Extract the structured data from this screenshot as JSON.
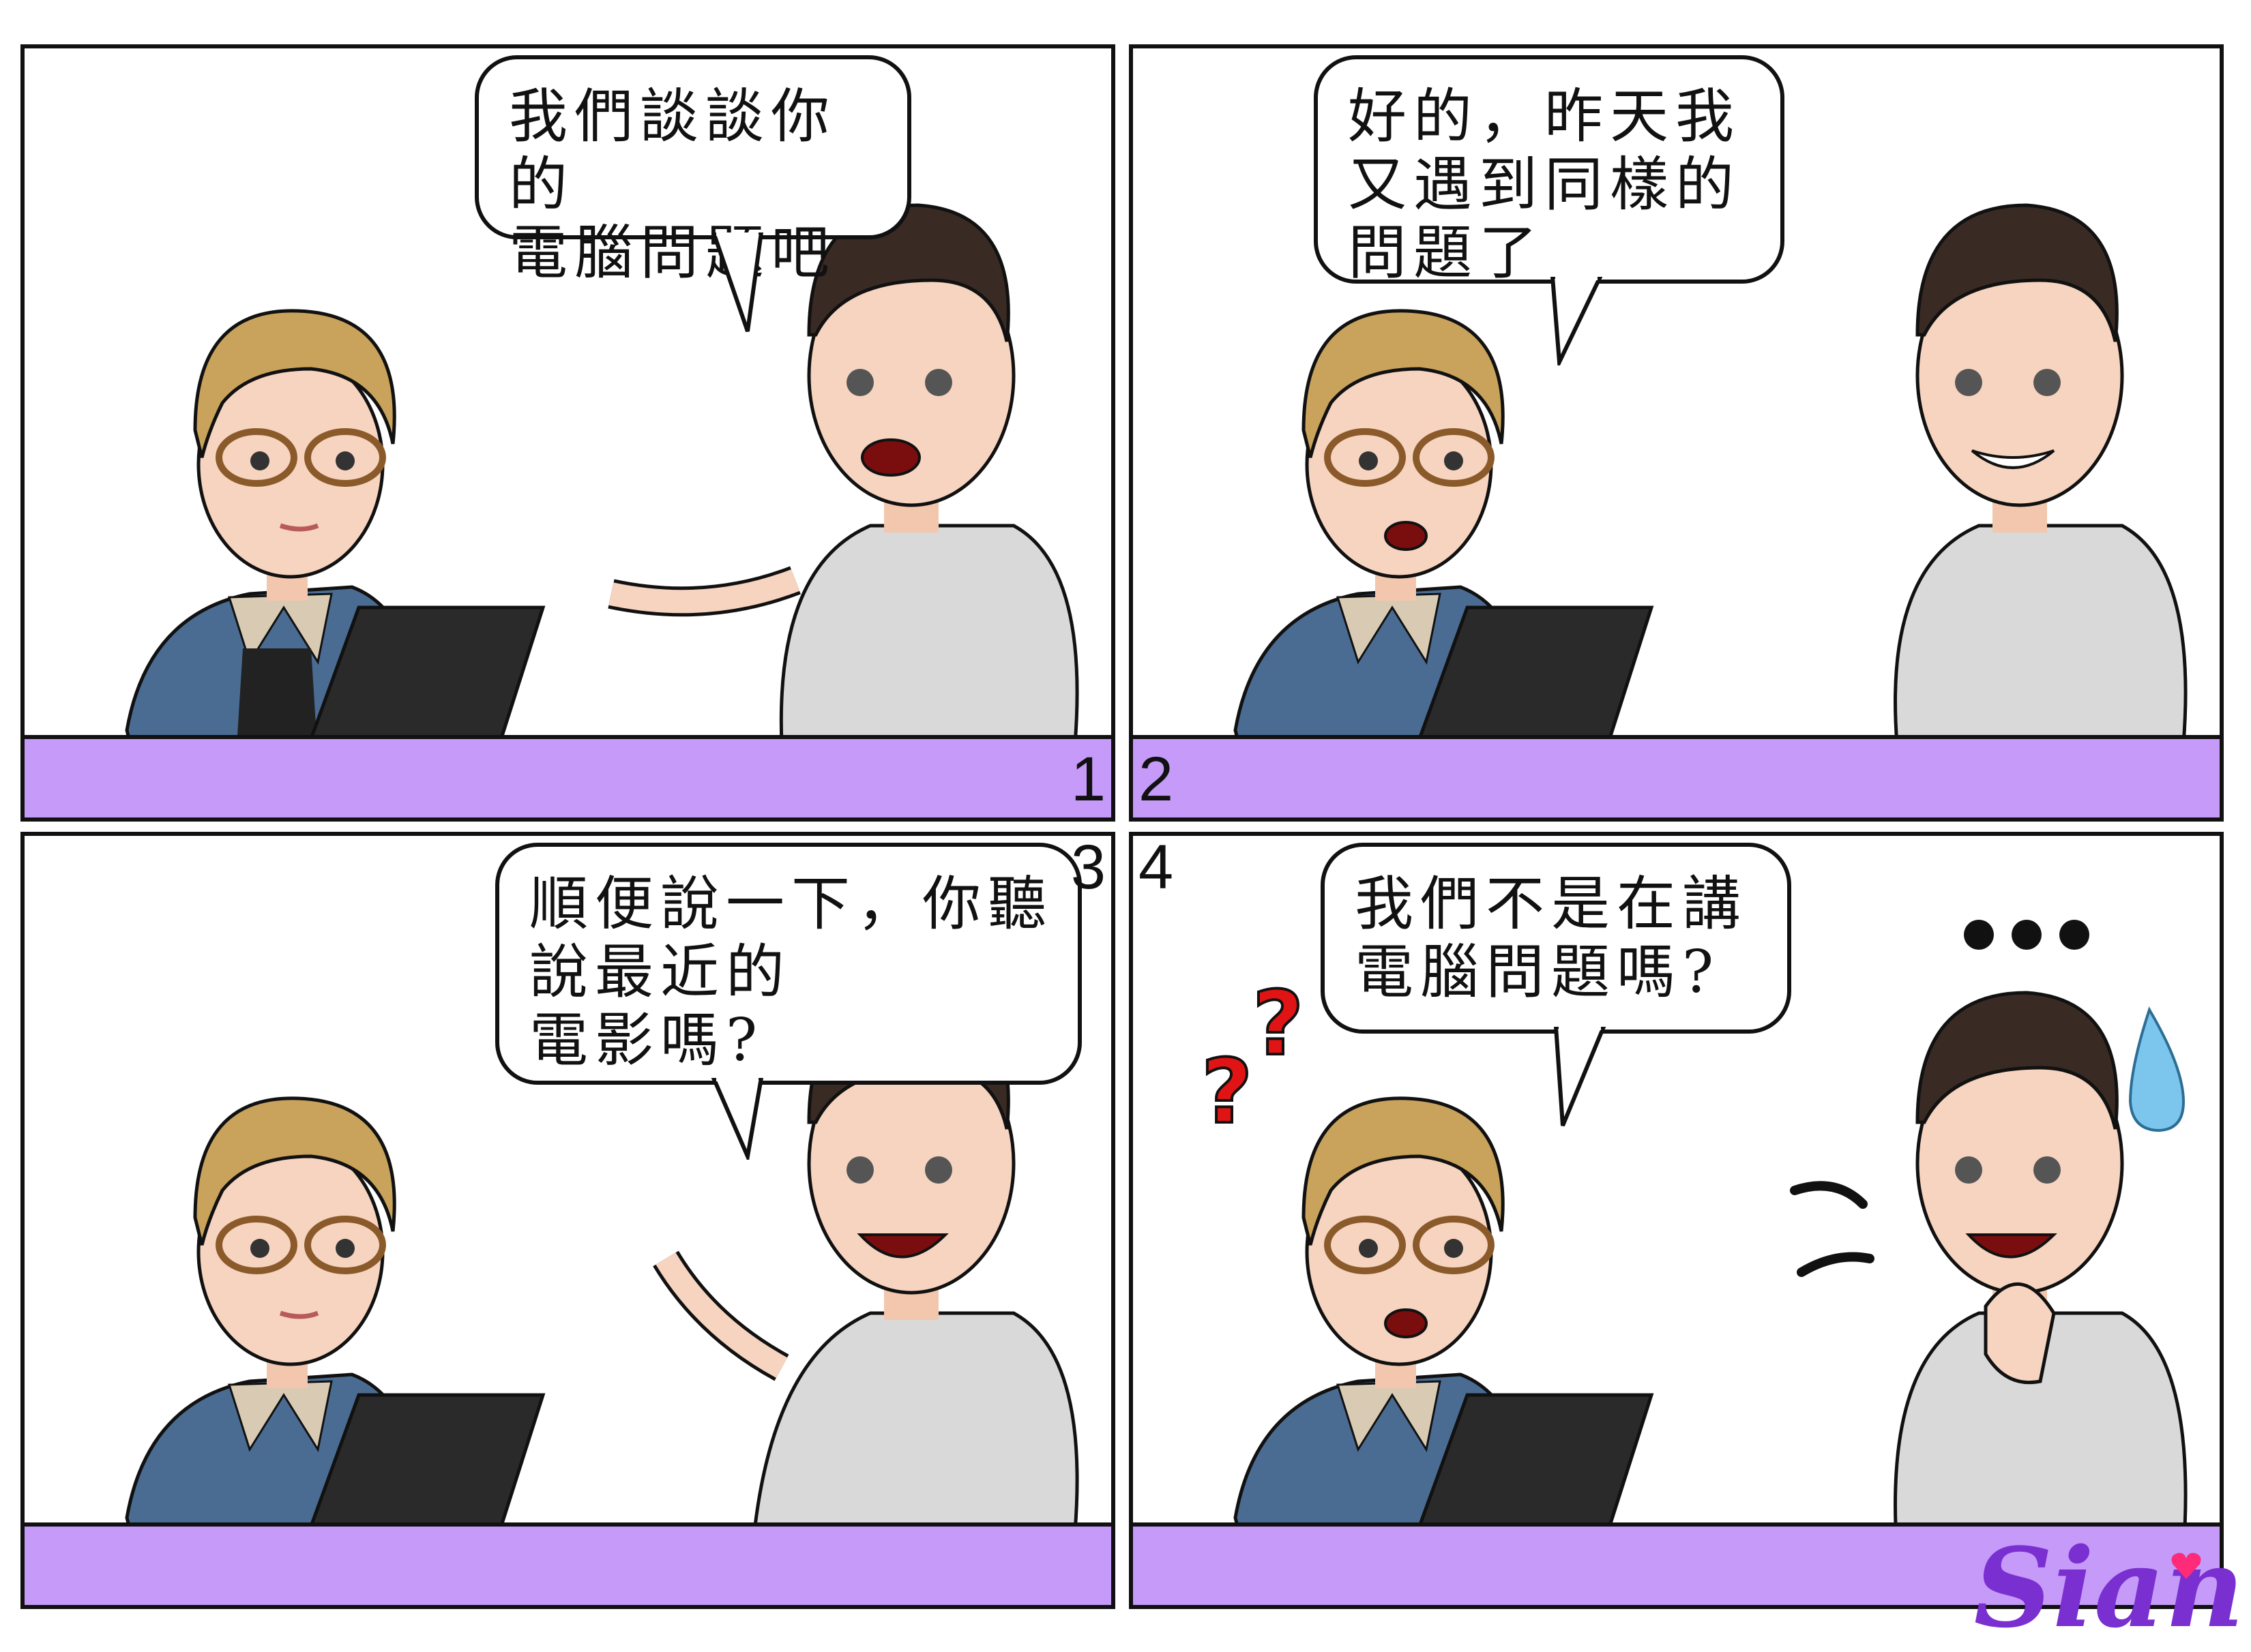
{
  "panels": [
    {
      "number": "1",
      "speech": "我們談談你的\n電腦問題吧"
    },
    {
      "number": "2",
      "speech": "好的，昨天我\n又遇到同樣的\n問題了"
    },
    {
      "number": "3",
      "speech": "順便說一下，你聽\n說最近的\n電影嗎?"
    },
    {
      "number": "4",
      "speech": "我們不是在講\n電腦問題嗎?"
    }
  ],
  "signature": "Sian",
  "colors": {
    "desk": "#c59af8",
    "border": "#111111",
    "jacket": "#4a6c93",
    "hair_woman": "#c9a35c",
    "hair_man": "#3a2a24",
    "shirt": "#d9d9d9",
    "laptop": "#2a2a2a",
    "question_marks": "#e01414",
    "sweat_drop": "#7cc6ee",
    "signature": "#7a2fd0"
  },
  "decorations": [
    "question-marks",
    "ellipsis-dots",
    "sweat-drop",
    "surprise-marks"
  ]
}
